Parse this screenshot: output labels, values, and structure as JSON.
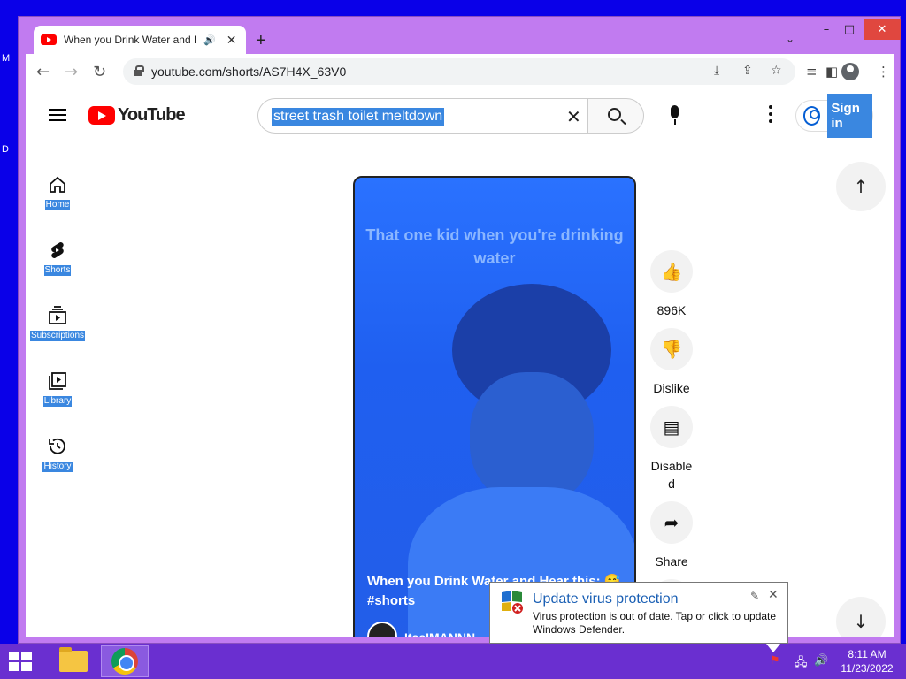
{
  "desktop": {
    "stray_letters": [
      "M",
      "D"
    ]
  },
  "window_controls": {
    "minimize": "–",
    "maximize": "□",
    "close": "✕"
  },
  "browser": {
    "tab": {
      "title": "When you Drink Water and H",
      "audio_icon": "speaker-icon",
      "close": "✕"
    },
    "new_tab": "+",
    "tab_list": "⌄",
    "url": "youtube.com/shorts/AS7H4X_63V0"
  },
  "youtube": {
    "logo_text": "YouTube",
    "search": {
      "value": "street trash toilet meltdown",
      "clear": "✕"
    },
    "sign_in": "Sign in",
    "sidebar": [
      {
        "label": "Home",
        "icon": "home-icon"
      },
      {
        "label": "Shorts",
        "icon": "shorts-icon"
      },
      {
        "label": "Subscriptions",
        "icon": "subscriptions-icon"
      },
      {
        "label": "Library",
        "icon": "library-icon"
      },
      {
        "label": "History",
        "icon": "history-icon"
      }
    ],
    "short": {
      "caption": "That one kid when you're drinking water",
      "title": "When you Drink Water and Hear this: 😅 #shorts",
      "channel": "ItssIMANNN"
    },
    "actions": {
      "like": {
        "icon": "thumbs-up-icon",
        "label": "896K"
      },
      "dislike": {
        "icon": "thumbs-down-icon",
        "label": "Dislike"
      },
      "comments": {
        "icon": "comment-icon",
        "label": "Disable d"
      },
      "share": {
        "icon": "share-icon",
        "label": "Share"
      }
    },
    "nav": {
      "up": "↑",
      "down": "↓"
    }
  },
  "notification": {
    "title": "Update virus protection",
    "body": "Virus protection is out of date. Tap or click to update Windows Defender."
  },
  "taskbar": {
    "time": "8:11 AM",
    "date": "11/23/2022"
  }
}
